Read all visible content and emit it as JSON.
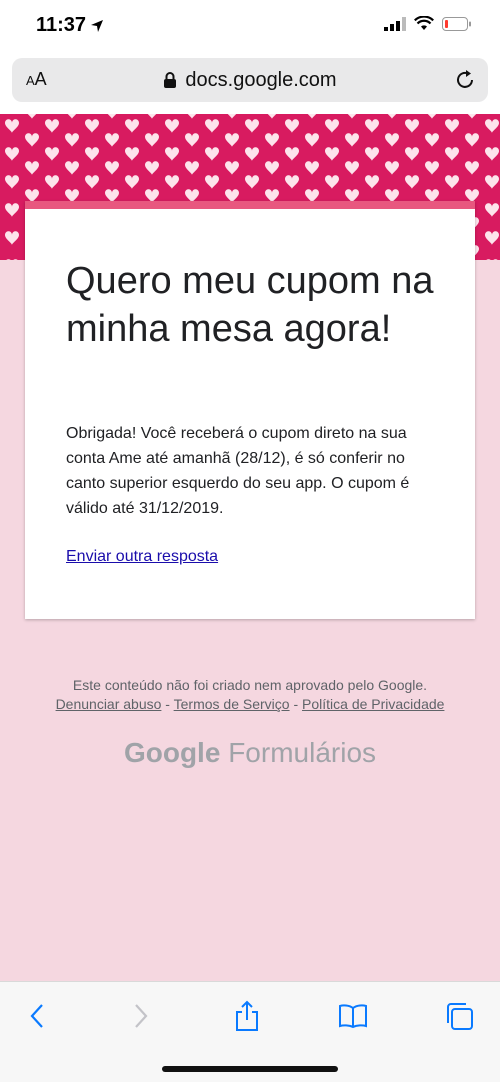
{
  "status_bar": {
    "time": "11:37",
    "icons": [
      "location-arrow-icon",
      "signal-icon",
      "wifi-icon",
      "battery-low-icon"
    ]
  },
  "browser": {
    "text_size_label": "AA",
    "url": "docs.google.com",
    "icons": [
      "lock-icon",
      "reload-icon"
    ]
  },
  "form": {
    "title": "Quero meu cupom na minha mesa agora!",
    "confirmation_message": "Obrigada! Você receberá o cupom direto na sua conta Ame até amanhã (28/12), é só conferir no canto superior esquerdo do seu app. O cupom é válido até 31/12/2019.",
    "another_response_link": "Enviar outra resposta",
    "accent_color": "#d81b60"
  },
  "footer": {
    "disclaimer": "Este conteúdo não foi criado nem aprovado pelo Google.",
    "report_abuse": "Denunciar abuso",
    "separator": " - ",
    "terms": "Termos de Serviço",
    "privacy": "Política de Privacidade",
    "brand_google": "Google",
    "brand_product": "Formulários"
  },
  "toolbar": {
    "icons": [
      "back-icon",
      "forward-icon",
      "share-icon",
      "bookmarks-icon",
      "tabs-icon"
    ]
  }
}
